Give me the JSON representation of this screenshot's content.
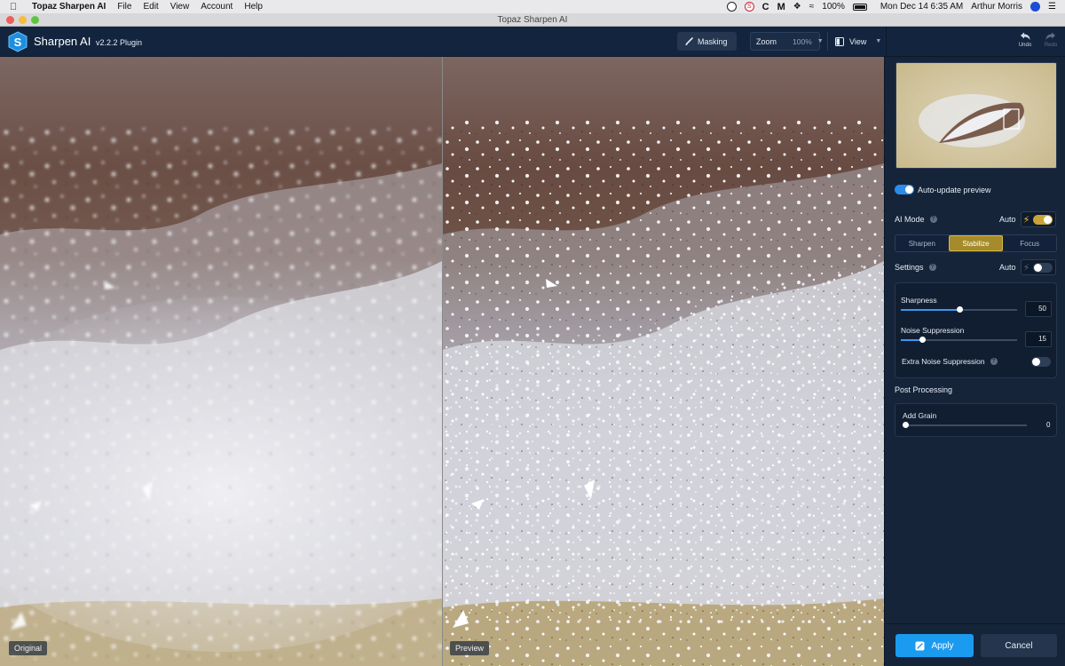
{
  "menubar": {
    "app_name": "Topaz Sharpen AI",
    "items": [
      "File",
      "Edit",
      "View",
      "Account",
      "Help"
    ],
    "battery": "100%",
    "datetime": "Mon Dec 14  6:35 AM",
    "user": "Arthur Morris"
  },
  "window": {
    "title": "Topaz Sharpen AI"
  },
  "toolbar": {
    "app_title": "Sharpen AI",
    "version": "v2.2.2 Plugin",
    "masking_label": "Masking",
    "zoom_label": "Zoom",
    "zoom_value": "100%",
    "view_label": "View",
    "undo_label": "Undo",
    "redo_label": "Redo"
  },
  "panes": {
    "left_label": "Original",
    "right_label": "Preview"
  },
  "panel": {
    "auto_update_label": "Auto-update preview",
    "ai_mode_label": "AI Mode",
    "ai_mode_auto": "Auto",
    "modes": [
      "Sharpen",
      "Stabilize",
      "Focus"
    ],
    "active_mode": "Stabilize",
    "settings_label": "Settings",
    "settings_auto": "Auto",
    "sliders": [
      {
        "label": "Sharpness",
        "value": "50",
        "fraction": 0.5
      },
      {
        "label": "Noise Suppression",
        "value": "15",
        "fraction": 0.18
      }
    ],
    "extra_noise_label": "Extra Noise Suppression",
    "post_processing_label": "Post Processing",
    "grain": {
      "label": "Add Grain",
      "value": "0",
      "fraction": 0.02
    },
    "apply_label": "Apply",
    "cancel_label": "Cancel"
  },
  "colors": {
    "accent_blue": "#1a9bf0",
    "accent_gold": "#c9a335",
    "panel_bg": "#16243a"
  }
}
